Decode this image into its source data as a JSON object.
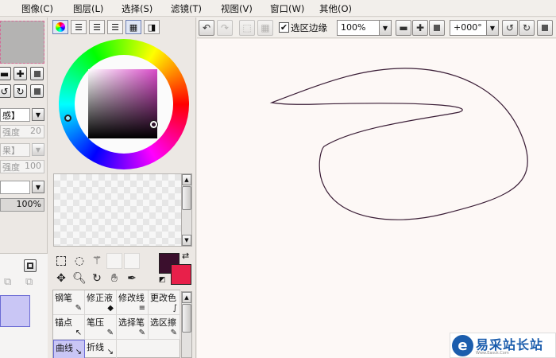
{
  "menu": [
    "图像(C)",
    "图层(L)",
    "选择(S)",
    "滤镜(T)",
    "视图(V)",
    "窗口(W)",
    "其他(O)"
  ],
  "toolbar": {
    "undo_icon": "undo-icon",
    "redo_icon": "redo-icon",
    "selection_border_checked": true,
    "selection_border_label": "选区边缘",
    "zoom_value": "100%",
    "rotation_value": "+000°"
  },
  "left_panel": {
    "row1_text": "感】",
    "strength1_label": "强度",
    "strength1_value": "20",
    "row3_text": "果】",
    "strength2_label": "强度",
    "strength2_value": "100",
    "opacity_value": "100%"
  },
  "color_panel": {
    "main_color": "#3b0f2d",
    "sub_color": "#e8204a",
    "hue_color": "#d94bc9"
  },
  "brushes": [
    {
      "label": "钢笔",
      "icon": "✎"
    },
    {
      "label": "修正液",
      "icon": "◆"
    },
    {
      "label": "修改线",
      "icon": "≡"
    },
    {
      "label": "更改色",
      "icon": "∫"
    },
    {
      "label": "锚点",
      "icon": "↖"
    },
    {
      "label": "笔压",
      "icon": "✎"
    },
    {
      "label": "选择笔",
      "icon": "✎"
    },
    {
      "label": "选区擦",
      "icon": "✎"
    },
    {
      "label": "曲线",
      "icon": "↘"
    },
    {
      "label": "折线",
      "icon": "↘"
    }
  ],
  "watermark": {
    "text": "易采站长站",
    "sub": "Www.Easck.Com"
  }
}
